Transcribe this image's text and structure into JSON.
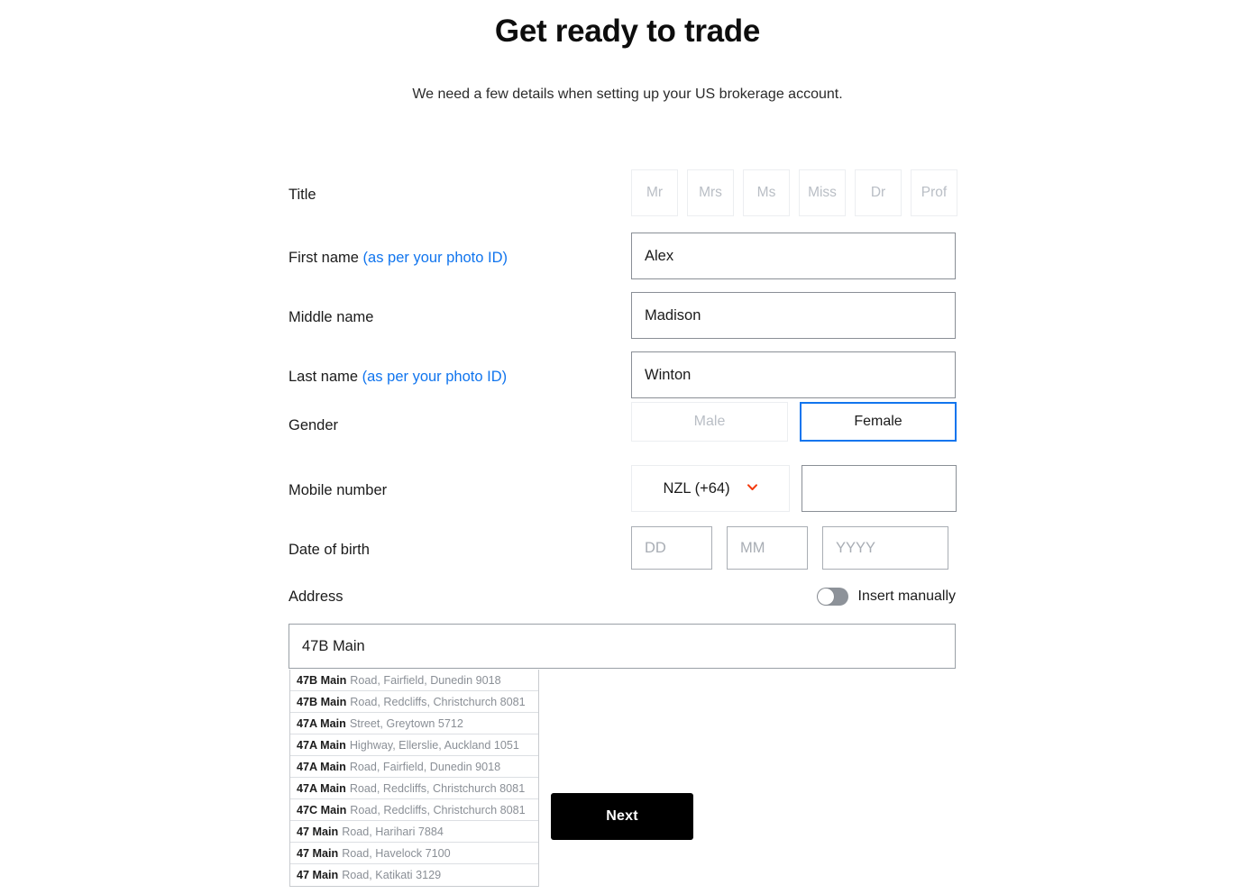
{
  "header": {
    "title": "Get ready to trade",
    "subtitle": "We need a few details when setting up your US brokerage account."
  },
  "form": {
    "title_field": {
      "label": "Title",
      "options": [
        "Mr",
        "Mrs",
        "Ms",
        "Miss",
        "Dr",
        "Prof"
      ],
      "selected": ""
    },
    "first_name": {
      "label": "First name",
      "hint": "(as per your photo ID)",
      "value": "Alex",
      "placeholder": ""
    },
    "middle_name": {
      "label": "Middle name",
      "hint": "",
      "value": "Madison",
      "placeholder": ""
    },
    "last_name": {
      "label": "Last name",
      "hint": "(as per your photo ID)",
      "value": "Winton",
      "placeholder": ""
    },
    "gender": {
      "label": "Gender",
      "options": [
        "Male",
        "Female"
      ],
      "selected": "Female"
    },
    "mobile": {
      "label": "Mobile number",
      "country": "NZL (+64)",
      "number_value": "",
      "number_placeholder": ""
    },
    "dob": {
      "label": "Date of birth",
      "day_placeholder": "DD",
      "day_value": "",
      "month_placeholder": "MM",
      "month_value": "",
      "year_placeholder": "YYYY",
      "year_value": ""
    },
    "address": {
      "label": "Address",
      "toggle_label": "Insert manually",
      "toggle_on": false,
      "value": "47B Main",
      "placeholder": "",
      "suggestions": [
        {
          "match": "47B Main",
          "rest": "Road, Fairfield, Dunedin 9018"
        },
        {
          "match": "47B Main",
          "rest": "Road, Redcliffs, Christchurch 8081"
        },
        {
          "match": "47A Main",
          "rest": "Street, Greytown 5712"
        },
        {
          "match": "47A Main",
          "rest": "Highway, Ellerslie, Auckland 1051"
        },
        {
          "match": "47A Main",
          "rest": "Road, Fairfield, Dunedin 9018"
        },
        {
          "match": "47A Main",
          "rest": "Road, Redcliffs, Christchurch 8081"
        },
        {
          "match": "47C Main",
          "rest": "Road, Redcliffs, Christchurch 8081"
        },
        {
          "match": "47 Main",
          "rest": "Road, Harihari 7884"
        },
        {
          "match": "47 Main",
          "rest": "Road, Havelock 7100"
        },
        {
          "match": "47 Main",
          "rest": "Road, Katikati 3129"
        }
      ]
    },
    "next_label": "Next"
  },
  "colors": {
    "accent_blue": "#1175ee",
    "chevron_red": "#f4390c",
    "button_black": "#000000"
  }
}
